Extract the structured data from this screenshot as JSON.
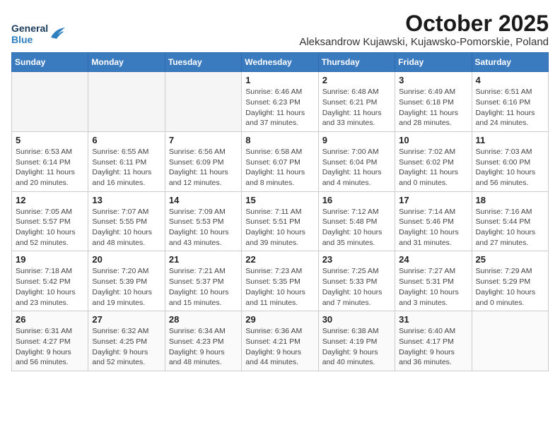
{
  "header": {
    "logo_general": "General",
    "logo_blue": "Blue",
    "month": "October 2025",
    "location": "Aleksandrow Kujawski, Kujawsko-Pomorskie, Poland"
  },
  "days_of_week": [
    "Sunday",
    "Monday",
    "Tuesday",
    "Wednesday",
    "Thursday",
    "Friday",
    "Saturday"
  ],
  "weeks": [
    [
      {
        "day": "",
        "info": ""
      },
      {
        "day": "",
        "info": ""
      },
      {
        "day": "",
        "info": ""
      },
      {
        "day": "1",
        "info": "Sunrise: 6:46 AM\nSunset: 6:23 PM\nDaylight: 11 hours\nand 37 minutes."
      },
      {
        "day": "2",
        "info": "Sunrise: 6:48 AM\nSunset: 6:21 PM\nDaylight: 11 hours\nand 33 minutes."
      },
      {
        "day": "3",
        "info": "Sunrise: 6:49 AM\nSunset: 6:18 PM\nDaylight: 11 hours\nand 28 minutes."
      },
      {
        "day": "4",
        "info": "Sunrise: 6:51 AM\nSunset: 6:16 PM\nDaylight: 11 hours\nand 24 minutes."
      }
    ],
    [
      {
        "day": "5",
        "info": "Sunrise: 6:53 AM\nSunset: 6:14 PM\nDaylight: 11 hours\nand 20 minutes."
      },
      {
        "day": "6",
        "info": "Sunrise: 6:55 AM\nSunset: 6:11 PM\nDaylight: 11 hours\nand 16 minutes."
      },
      {
        "day": "7",
        "info": "Sunrise: 6:56 AM\nSunset: 6:09 PM\nDaylight: 11 hours\nand 12 minutes."
      },
      {
        "day": "8",
        "info": "Sunrise: 6:58 AM\nSunset: 6:07 PM\nDaylight: 11 hours\nand 8 minutes."
      },
      {
        "day": "9",
        "info": "Sunrise: 7:00 AM\nSunset: 6:04 PM\nDaylight: 11 hours\nand 4 minutes."
      },
      {
        "day": "10",
        "info": "Sunrise: 7:02 AM\nSunset: 6:02 PM\nDaylight: 11 hours\nand 0 minutes."
      },
      {
        "day": "11",
        "info": "Sunrise: 7:03 AM\nSunset: 6:00 PM\nDaylight: 10 hours\nand 56 minutes."
      }
    ],
    [
      {
        "day": "12",
        "info": "Sunrise: 7:05 AM\nSunset: 5:57 PM\nDaylight: 10 hours\nand 52 minutes."
      },
      {
        "day": "13",
        "info": "Sunrise: 7:07 AM\nSunset: 5:55 PM\nDaylight: 10 hours\nand 48 minutes."
      },
      {
        "day": "14",
        "info": "Sunrise: 7:09 AM\nSunset: 5:53 PM\nDaylight: 10 hours\nand 43 minutes."
      },
      {
        "day": "15",
        "info": "Sunrise: 7:11 AM\nSunset: 5:51 PM\nDaylight: 10 hours\nand 39 minutes."
      },
      {
        "day": "16",
        "info": "Sunrise: 7:12 AM\nSunset: 5:48 PM\nDaylight: 10 hours\nand 35 minutes."
      },
      {
        "day": "17",
        "info": "Sunrise: 7:14 AM\nSunset: 5:46 PM\nDaylight: 10 hours\nand 31 minutes."
      },
      {
        "day": "18",
        "info": "Sunrise: 7:16 AM\nSunset: 5:44 PM\nDaylight: 10 hours\nand 27 minutes."
      }
    ],
    [
      {
        "day": "19",
        "info": "Sunrise: 7:18 AM\nSunset: 5:42 PM\nDaylight: 10 hours\nand 23 minutes."
      },
      {
        "day": "20",
        "info": "Sunrise: 7:20 AM\nSunset: 5:39 PM\nDaylight: 10 hours\nand 19 minutes."
      },
      {
        "day": "21",
        "info": "Sunrise: 7:21 AM\nSunset: 5:37 PM\nDaylight: 10 hours\nand 15 minutes."
      },
      {
        "day": "22",
        "info": "Sunrise: 7:23 AM\nSunset: 5:35 PM\nDaylight: 10 hours\nand 11 minutes."
      },
      {
        "day": "23",
        "info": "Sunrise: 7:25 AM\nSunset: 5:33 PM\nDaylight: 10 hours\nand 7 minutes."
      },
      {
        "day": "24",
        "info": "Sunrise: 7:27 AM\nSunset: 5:31 PM\nDaylight: 10 hours\nand 3 minutes."
      },
      {
        "day": "25",
        "info": "Sunrise: 7:29 AM\nSunset: 5:29 PM\nDaylight: 10 hours\nand 0 minutes."
      }
    ],
    [
      {
        "day": "26",
        "info": "Sunrise: 6:31 AM\nSunset: 4:27 PM\nDaylight: 9 hours\nand 56 minutes."
      },
      {
        "day": "27",
        "info": "Sunrise: 6:32 AM\nSunset: 4:25 PM\nDaylight: 9 hours\nand 52 minutes."
      },
      {
        "day": "28",
        "info": "Sunrise: 6:34 AM\nSunset: 4:23 PM\nDaylight: 9 hours\nand 48 minutes."
      },
      {
        "day": "29",
        "info": "Sunrise: 6:36 AM\nSunset: 4:21 PM\nDaylight: 9 hours\nand 44 minutes."
      },
      {
        "day": "30",
        "info": "Sunrise: 6:38 AM\nSunset: 4:19 PM\nDaylight: 9 hours\nand 40 minutes."
      },
      {
        "day": "31",
        "info": "Sunrise: 6:40 AM\nSunset: 4:17 PM\nDaylight: 9 hours\nand 36 minutes."
      },
      {
        "day": "",
        "info": ""
      }
    ]
  ]
}
